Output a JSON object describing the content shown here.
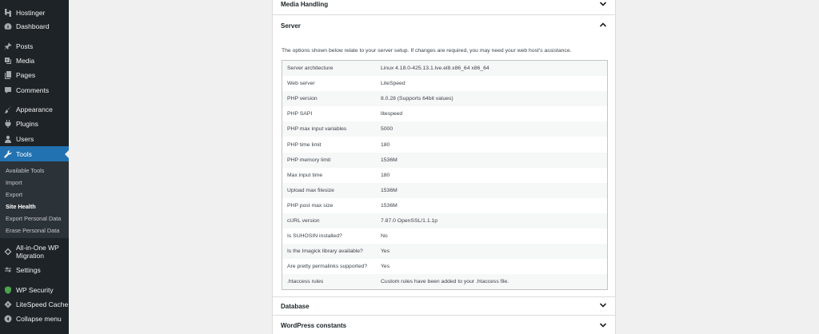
{
  "sidebar": {
    "top": [
      {
        "label": "Hostinger",
        "icon": "hostinger-icon"
      },
      {
        "label": "Dashboard",
        "icon": "dashboard-icon"
      },
      {
        "label": "Posts",
        "icon": "pin-icon"
      },
      {
        "label": "Media",
        "icon": "media-icon"
      },
      {
        "label": "Pages",
        "icon": "pages-icon"
      },
      {
        "label": "Comments",
        "icon": "comments-icon"
      },
      {
        "label": "Appearance",
        "icon": "brush-icon"
      },
      {
        "label": "Plugins",
        "icon": "plugin-icon"
      },
      {
        "label": "Users",
        "icon": "users-icon"
      },
      {
        "label": "Tools",
        "icon": "wrench-icon"
      }
    ],
    "submenu": [
      "Available Tools",
      "Import",
      "Export",
      "Site Health",
      "Export Personal Data",
      "Erase Personal Data"
    ],
    "bottom": [
      {
        "label_line1": "All-in-One WP",
        "label_line2": "Migration",
        "icon": "migration-icon"
      },
      {
        "label": "Settings",
        "icon": "settings-icon"
      },
      {
        "label": "WP Security",
        "icon": "shield-icon"
      },
      {
        "label": "LiteSpeed Cache",
        "icon": "litespeed-icon"
      },
      {
        "label": "Collapse menu",
        "icon": "collapse-icon"
      }
    ],
    "accent": "#2271b1"
  },
  "sections": {
    "media_handling": "Media Handling",
    "server": "Server",
    "database": "Database",
    "wp_constants": "WordPress constants"
  },
  "server": {
    "description": "The options shown below relate to your server setup. If changes are required, you may need your web host's assistance.",
    "rows": [
      {
        "key": "Server architecture",
        "value": "Linux 4.18.0-425.13.1.lve.el8.x86_64 x86_64"
      },
      {
        "key": "Web server",
        "value": "LiteSpeed"
      },
      {
        "key": "PHP version",
        "value": "8.0.28 (Supports 64bit values)"
      },
      {
        "key": "PHP SAPI",
        "value": "litespeed"
      },
      {
        "key": "PHP max input variables",
        "value": "5000"
      },
      {
        "key": "PHP time limit",
        "value": "180"
      },
      {
        "key": "PHP memory limit",
        "value": "1536M"
      },
      {
        "key": "Max input time",
        "value": "180"
      },
      {
        "key": "Upload max filesize",
        "value": "1536M"
      },
      {
        "key": "PHP post max size",
        "value": "1536M"
      },
      {
        "key": "cURL version",
        "value": "7.87.0 OpenSSL/1.1.1p"
      },
      {
        "key": "Is SUHOSIN installed?",
        "value": "No"
      },
      {
        "key": "Is the Imagick library available?",
        "value": "Yes"
      },
      {
        "key": "Are pretty permalinks supported?",
        "value": "Yes"
      },
      {
        "key": ".htaccess rules",
        "value": "Custom rules have been added to your .htaccess file."
      }
    ]
  }
}
